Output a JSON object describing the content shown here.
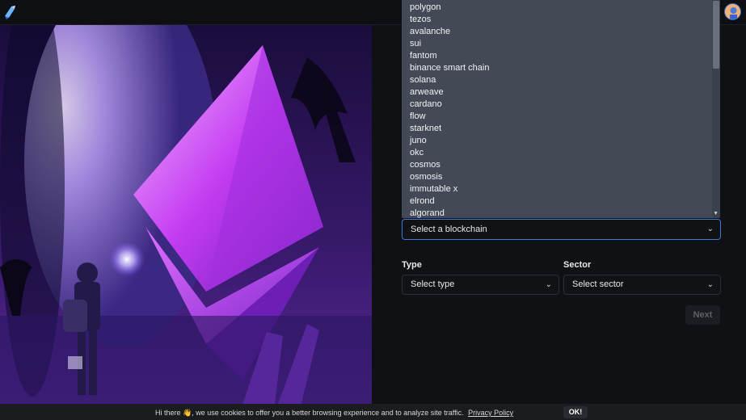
{
  "header": {
    "logo_icon": "app-logo-icon",
    "avatar_icon": "user-avatar-icon"
  },
  "blockchain_dropdown": {
    "options": [
      "polygon",
      "tezos",
      "avalanche",
      "sui",
      "fantom",
      "binance smart chain",
      "solana",
      "arweave",
      "cardano",
      "flow",
      "starknet",
      "juno",
      "okc",
      "cosmos",
      "osmosis",
      "immutable x",
      "elrond",
      "algorand"
    ],
    "selected_text": "Select a blockchain"
  },
  "type_field": {
    "label": "Type",
    "placeholder": "Select type"
  },
  "sector_field": {
    "label": "Sector",
    "placeholder": "Select sector"
  },
  "next_button": {
    "label": "Next"
  },
  "cookie_banner": {
    "message": "Hi there 👋, we use cookies to offer you a better browsing experience and to analyze site traffic.",
    "policy_link": "Privacy Policy",
    "ok_label": "OK!"
  },
  "colors": {
    "accent": "#3c79d8",
    "dropdown_bg": "#434a56",
    "page_bg": "#101114"
  }
}
